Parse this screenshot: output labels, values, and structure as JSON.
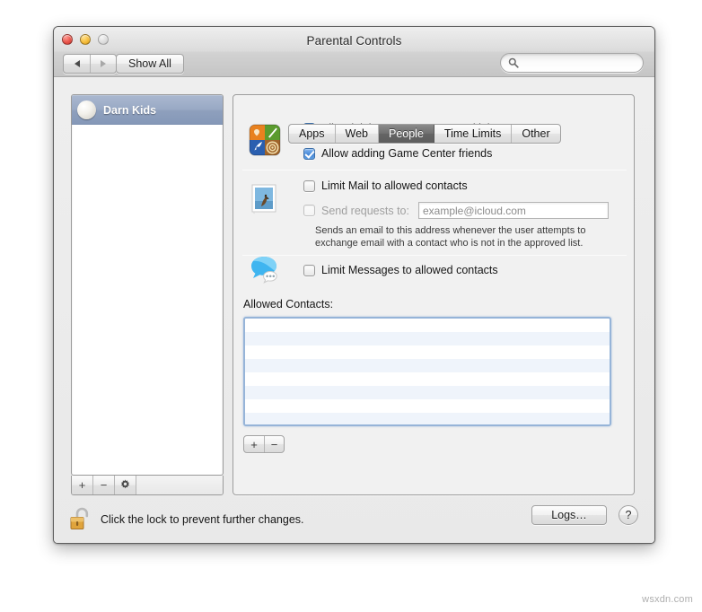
{
  "window": {
    "title": "Parental Controls",
    "traffic_lights": [
      "close",
      "minimize",
      "zoom"
    ]
  },
  "toolbar": {
    "back_icon": "triangle-left-icon",
    "forward_icon": "triangle-right-icon",
    "show_all_label": "Show All",
    "search": {
      "value": "",
      "placeholder": "",
      "icon": "search-icon"
    }
  },
  "sidebar": {
    "accounts": [
      {
        "name": "Darn Kids",
        "avatar": "soccer-ball-icon",
        "selected": true
      }
    ],
    "buttons": [
      {
        "label": "+",
        "name": "add-account-button"
      },
      {
        "label": "−",
        "name": "remove-account-button"
      },
      {
        "label": "gear",
        "name": "action-gear-button"
      }
    ]
  },
  "tabs": [
    {
      "label": "Apps",
      "active": false
    },
    {
      "label": "Web",
      "active": false
    },
    {
      "label": "People",
      "active": true
    },
    {
      "label": "Time Limits",
      "active": false
    },
    {
      "label": "Other",
      "active": false
    }
  ],
  "sections": {
    "game_center": {
      "icon": "game-center-icon",
      "options": [
        {
          "label": "Allow joining Game Center multiplayer games",
          "checked": true
        },
        {
          "label": "Allow adding Game Center friends",
          "checked": true
        }
      ]
    },
    "mail": {
      "icon": "mail-stamp-icon",
      "limit_option": {
        "label": "Limit Mail to allowed contacts",
        "checked": false
      },
      "send_requests": {
        "label": "Send requests to:",
        "checked": false,
        "disabled": true,
        "email_value": "example@icloud.com"
      },
      "help_text_line1": "Sends an email to this address whenever the user attempts to",
      "help_text_line2": "exchange email with a contact who is not in the approved list."
    },
    "messages": {
      "icon": "messages-bubble-icon",
      "limit_option": {
        "label": "Limit Messages to allowed contacts",
        "checked": false
      }
    },
    "allowed_contacts": {
      "label": "Allowed Contacts:",
      "entries": [],
      "buttons": [
        {
          "label": "+",
          "name": "add-contact-button"
        },
        {
          "label": "−",
          "name": "remove-contact-button"
        }
      ]
    }
  },
  "bottom": {
    "lock_icon": "unlocked-padlock-icon",
    "lock_text": "Click the lock to prevent further changes.",
    "logs_label": "Logs…",
    "help_label": "?"
  },
  "watermark": "wsxdn.com",
  "colors": {
    "accent_blue": "#4182d4",
    "selection_blue": "#98a8c4",
    "active_tab_gray": "#6f6f6f",
    "list_stripe": "#eff4fb"
  }
}
